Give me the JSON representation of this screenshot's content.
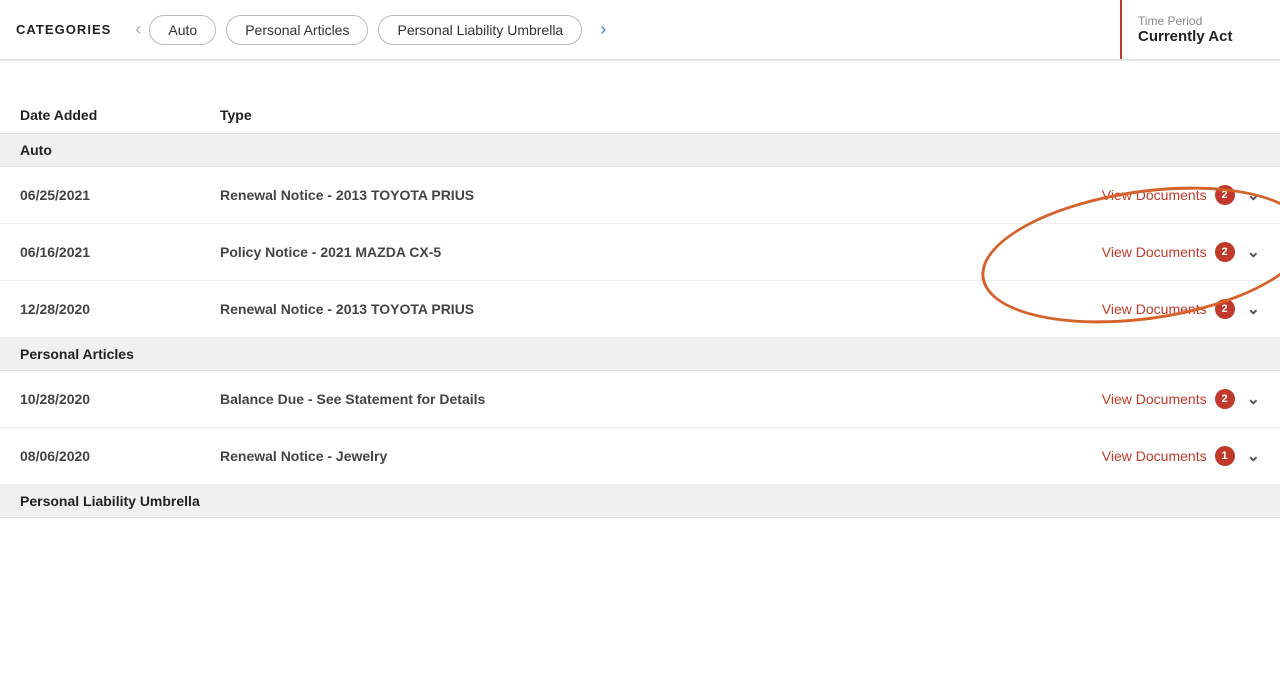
{
  "header": {
    "categories_label": "CATEGORIES",
    "nav_prev_label": "‹",
    "nav_next_label": "›",
    "tabs": [
      {
        "id": "auto",
        "label": "Auto"
      },
      {
        "id": "personal-articles",
        "label": "Personal Articles"
      },
      {
        "id": "personal-liability-umbrella",
        "label": "Personal Liability Umbrella"
      }
    ],
    "time_period": {
      "label": "Time Period",
      "value": "Currently Act"
    }
  },
  "table": {
    "columns": {
      "date_added": "Date Added",
      "type": "Type"
    },
    "sections": [
      {
        "section_title": "Auto",
        "rows": [
          {
            "date": "06/25/2021",
            "type": "Renewal Notice - 2013 TOYOTA PRIUS",
            "action_label": "View Documents",
            "badge_count": "2"
          },
          {
            "date": "06/16/2021",
            "type": "Policy Notice - 2021 MAZDA CX-5",
            "action_label": "View Documents",
            "badge_count": "2"
          },
          {
            "date": "12/28/2020",
            "type": "Renewal Notice - 2013 TOYOTA PRIUS",
            "action_label": "View Documents",
            "badge_count": "2"
          }
        ]
      },
      {
        "section_title": "Personal Articles",
        "rows": [
          {
            "date": "10/28/2020",
            "type": "Balance Due - See Statement for Details",
            "action_label": "View Documents",
            "badge_count": "2"
          },
          {
            "date": "08/06/2020",
            "type": "Renewal Notice - Jewelry",
            "action_label": "View Documents",
            "badge_count": "1"
          }
        ]
      },
      {
        "section_title": "Personal Liability Umbrella",
        "rows": []
      }
    ]
  }
}
